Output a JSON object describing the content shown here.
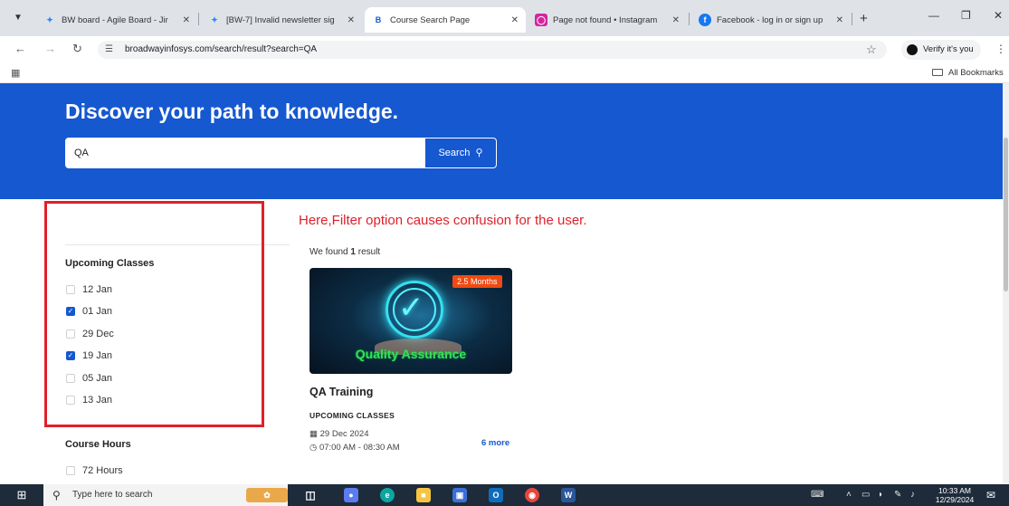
{
  "browser": {
    "tabs": [
      {
        "title": "BW board - Agile Board - Jir",
        "icon": "jira-icon",
        "icon_color": "#2684ff"
      },
      {
        "title": "[BW-7] Invalid newsletter sig",
        "icon": "jira-icon",
        "icon_color": "#2684ff"
      },
      {
        "title": "Course Search Page",
        "icon": "site-logo-icon",
        "icon_color": "#1558d0"
      },
      {
        "title": "Page not found • Instagram",
        "icon": "instagram-icon",
        "icon_color": "#d6249f"
      },
      {
        "title": "Facebook - log in or sign up",
        "icon": "facebook-icon",
        "icon_color": "#1877f2"
      }
    ],
    "url": "broadwayinfosys.com/search/result?search=QA",
    "profile_label": "Verify it's you",
    "bookmarks_label": "All Bookmarks"
  },
  "hero": {
    "title": "Discover your path to knowledge.",
    "search_value": "QA",
    "search_button": "Search"
  },
  "filters": {
    "upcoming_heading": "Upcoming Classes",
    "upcoming_options": [
      {
        "label": "12 Jan",
        "checked": false
      },
      {
        "label": "01 Jan",
        "checked": true
      },
      {
        "label": "29 Dec",
        "checked": false
      },
      {
        "label": "19 Jan",
        "checked": true
      },
      {
        "label": "05 Jan",
        "checked": false
      },
      {
        "label": "13 Jan",
        "checked": false
      }
    ],
    "hours_heading": "Course Hours",
    "hours_options": [
      {
        "label": "72 Hours",
        "checked": false
      }
    ]
  },
  "annotation": {
    "text": "Here,Filter option causes confusion for the user.",
    "color": "#e0202a"
  },
  "results": {
    "prefix": "We found",
    "count": "1",
    "suffix": "result",
    "card": {
      "duration_badge": "2.5 Months",
      "image_caption": "Quality Assurance",
      "title": "QA Training",
      "upcoming_label": "UPCOMING CLASSES",
      "date": "29 Dec 2024",
      "time": "07:00 AM - 08:30 AM",
      "more_link": "6 more"
    }
  },
  "taskbar": {
    "search_placeholder": "Type here to search",
    "time": "10:33 AM",
    "date": "12/29/2024"
  },
  "colors": {
    "brand": "#1558d0",
    "badge": "#f04a12",
    "caption": "#37e05a"
  }
}
